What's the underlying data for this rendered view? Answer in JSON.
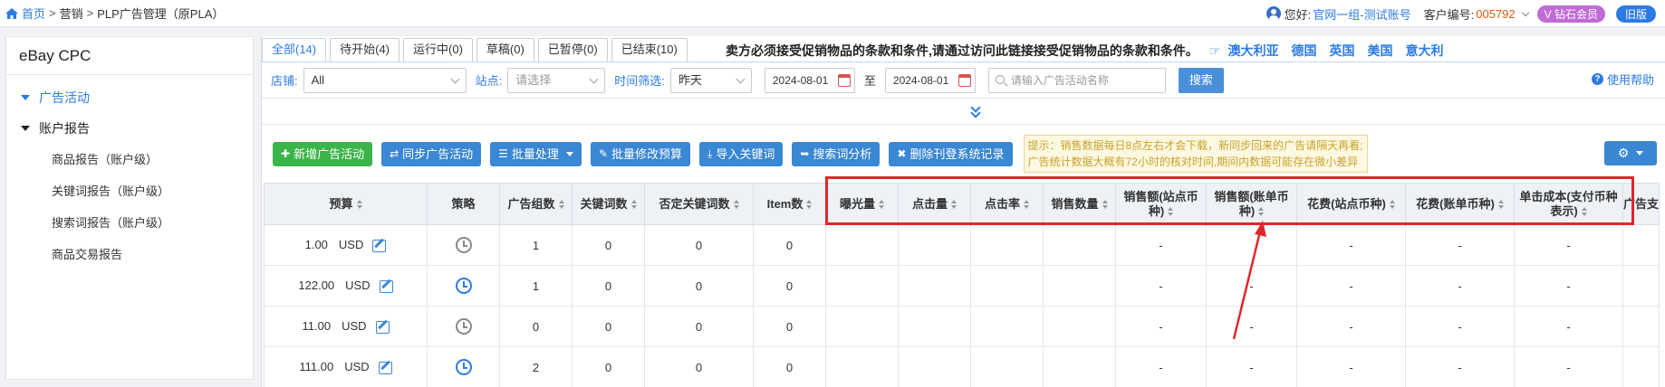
{
  "topbar": {
    "breadcrumb": [
      "首页",
      "营销",
      "PLP广告管理（原PLA）"
    ],
    "greeting": "您好:",
    "username": "官网一组-测试账号",
    "customer_label": "客户编号:",
    "customer_no": "005792",
    "vip_label": "V 钻石会员",
    "old_version": "旧版"
  },
  "sidebar": {
    "title": "eBay CPC",
    "groups": [
      {
        "label": "广告活动"
      },
      {
        "label": "账户报告"
      }
    ],
    "items": [
      "商品报告（账户级）",
      "关键词报告（账户级）",
      "搜索词报告（账户级）",
      "商品交易报告"
    ]
  },
  "tabs": [
    "全部(14)",
    "待开始(4)",
    "运行中(0)",
    "草稿(0)",
    "已暂停(0)",
    "已结束(10)"
  ],
  "notice": {
    "text": "卖方必须接受促销物品的条款和条件,请通过访问此链接接受促销物品的条款和条件。",
    "langs": [
      "澳大利亚",
      "德国",
      "英国",
      "美国",
      "意大利"
    ]
  },
  "filters": {
    "shop_label": "店铺:",
    "shop_value": "All",
    "site_label": "站点:",
    "site_placeholder": "请选择",
    "time_label": "时间筛选:",
    "time_value": "昨天",
    "date_from": "2024-08-01",
    "to_label": "至",
    "date_to": "2024-08-01",
    "search_placeholder": "请输入广告活动名称",
    "search_button": "搜索",
    "help": "使用帮助"
  },
  "actions": {
    "new": "新增广告活动",
    "sync": "同步广告活动",
    "batch": "批量处理",
    "batch_budget": "批量修改预算",
    "import_kw": "导入关键词",
    "search_analysis": "搜索词分析",
    "delete_log": "删除刊登系统记录",
    "tip_line1": "提示：销售数据每日8点左右才会下载，新同步回来的广告请隔天再看;",
    "tip_line2": "广告统计数据大概有72小时的核对时间,期间内数据可能存在微小差异"
  },
  "table": {
    "headers": [
      "预算",
      "策略",
      "广告组数",
      "关键词数",
      "否定关键词数",
      "Item数",
      "曝光量",
      "点击量",
      "点击率",
      "销售数量",
      "销售额(站点币种)",
      "销售额(账单币种)",
      "花费(站点币种)",
      "花费(账单币种)",
      "单击成本(支付币种表示)",
      "广告支"
    ],
    "rows": [
      {
        "budget": "1.00",
        "currency": "USD",
        "strategy": "grey",
        "groups": "1",
        "keywords": "0",
        "neg": "0",
        "items": "0",
        "c1": "",
        "c2": "",
        "c3": "",
        "c4": "",
        "c5": "-",
        "c6": "",
        "c7": "-",
        "c8": "-",
        "c9": "-"
      },
      {
        "budget": "122.00",
        "currency": "USD",
        "strategy": "blue",
        "groups": "1",
        "keywords": "0",
        "neg": "0",
        "items": "0",
        "c1": "",
        "c2": "",
        "c3": "",
        "c4": "",
        "c5": "-",
        "c6": "-",
        "c7": "-",
        "c8": "-",
        "c9": "-"
      },
      {
        "budget": "11.00",
        "currency": "USD",
        "strategy": "grey",
        "groups": "0",
        "keywords": "0",
        "neg": "0",
        "items": "0",
        "c1": "",
        "c2": "",
        "c3": "",
        "c4": "",
        "c5": "-",
        "c6": "-",
        "c7": "-",
        "c8": "-",
        "c9": "-"
      },
      {
        "budget": "111.00",
        "currency": "USD",
        "strategy": "blue",
        "groups": "2",
        "keywords": "0",
        "neg": "0",
        "items": "0",
        "c1": "",
        "c2": "",
        "c3": "",
        "c4": "",
        "c5": "-",
        "c6": "-",
        "c7": "-",
        "c8": "-",
        "c9": "-"
      }
    ]
  },
  "colors": {
    "accent": "#2c7be5",
    "green": "#3bb54a",
    "annotation": "#e0262a"
  }
}
